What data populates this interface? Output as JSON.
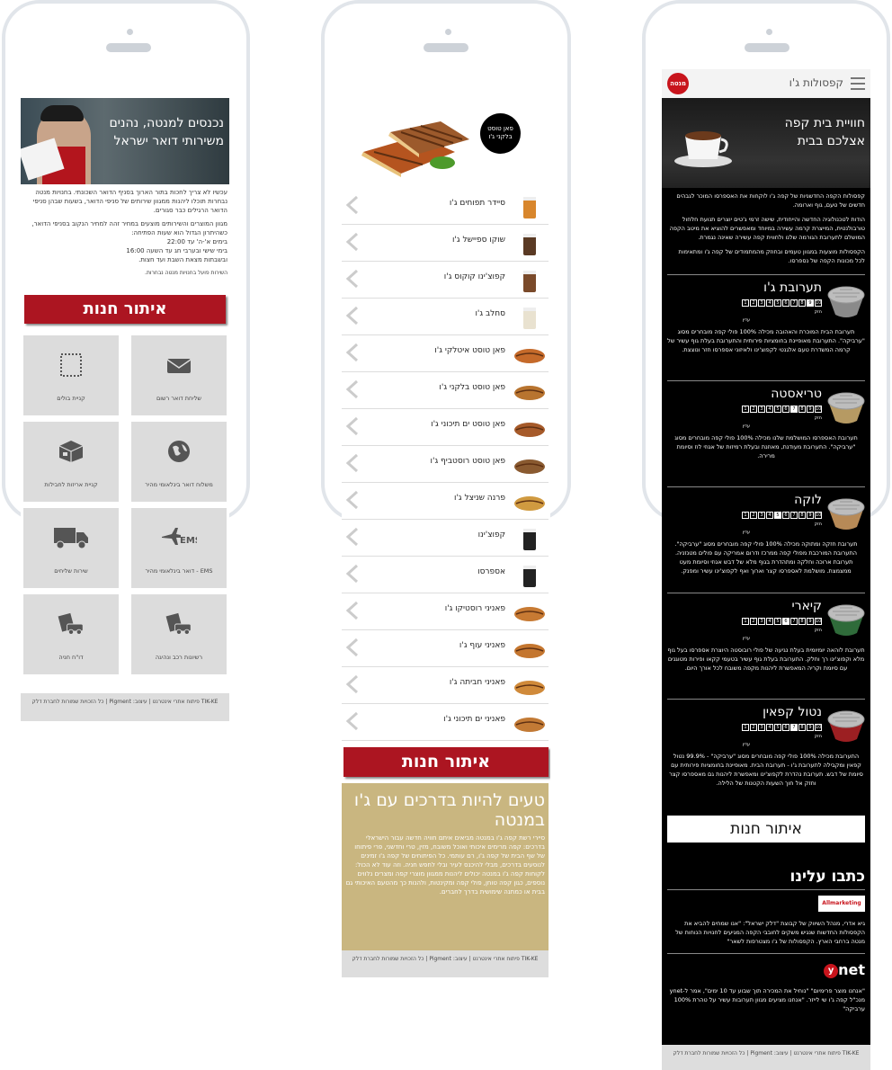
{
  "phone1": {
    "hero_title": "נכנסים למנטה, נהנים משירותי דואר ישראל",
    "paragraphs": [
      "עכשיו לא צריך לחכות בתור הארוך בסניף הדואר השכונתי. בחנויות מנטה נבחרות תוכלו ליהנות ממגוון שירותים של סניפי הדואר, בשעות שבהן סניפי הדואר הרגילים כבר סגורים.",
      "מגוון המוצרים והשירותים מוצעים במחיר זהה למחיר הנקוב בסניפי הדואר, כשהיתרון הגדול הוא שעות הפתיחה:",
      "בימים א'-ה' עד 22:00",
      "בימי שישי ובערבי חג עד השעה 16:00",
      "ובשבתות מצאת השבת ועד חצות.",
      "השירות פועל בחנויות מנטה נבחרות."
    ],
    "store_button": "איתור חנות",
    "tiles": [
      {
        "label": "שליחת דואר רשום",
        "icon": "envelope-icon"
      },
      {
        "label": "קניית בולים",
        "icon": "stamp-icon"
      },
      {
        "label": "משלוח דואר בינלאומי מהיר",
        "icon": "globe-icon"
      },
      {
        "label": "קניית אריזות לחבילות",
        "icon": "box-icon"
      },
      {
        "label": "EMS - דואר בינלאומי מהיר",
        "icon": "ems-plane-icon",
        "icon_text": "EMS"
      },
      {
        "label": "שירות שליחים",
        "icon": "truck-icon"
      },
      {
        "label": "רשיונות רכב ונהיגה",
        "icon": "car-document-icon"
      },
      {
        "label": "דו\"ח חניה",
        "icon": "parking-ticket-icon"
      }
    ],
    "footer": "TIK-KE פיתוח אתרי אינטרנט | עיצוב: Pigment | כל הזכויות שמורות לחברת דלק"
  },
  "phone2": {
    "badge": "פאן טוסט בלקני ג'ו",
    "menu_items": [
      "סיידר תפוחים ג'ו",
      "שוקו ספיישל ג'ו",
      "קפוצ'ינו קוקוס ג'ו",
      "סחלב ג'ו",
      "פאן טוסט איטלקי ג'ו",
      "פאן טוסט בלקני ג'ו",
      "פאן טוסט ים תיכוני ג'ו",
      "פאן טוסט רוסטביף ג'ו",
      "פרנה שניצל ג'ו",
      "קפוצ'ינו",
      "אספרסו",
      "פאניני רוסטיקו ג'ו",
      "פאניני עוף ג'ו",
      "פאניני חביתה ג'ו",
      "פאניני ים תיכוני ג'ו"
    ],
    "store_button": "איתור חנות",
    "promo_title": "טעים להיות בדרכים עם ג'ו במנטה",
    "promo_text": "סיירי רשת קפה ג'ו במנטה מביאים איתם חוויה חדשה עבור הישראלי בדרכים: קפה מרימים איכותי ואוכל משובח, מזין, טרי וחדשני, פרי פיתוחו של שף הבית של קפה ג'ו, רם עותמי. כל הפיתוחים של קפה ג'ו זמינים לנוסעים בדרכים, מבלי להיכנס לעיר ובלי לחפש חניה. וזה עוד לא הכול: לקוחות קפה ג'ו במנטה יכולים ליהנות ממגוון מוצרי קפה ומצרים נלווים נוספים, כגון קפה טוחן, פולי קפה ומקינטות, ולהנות כך מהטעם האיכותי גם בבית או כמתנה שימושית בדרך לחברים.",
    "footer": "TIK-KE פיתוח אתרי אינטרנט | עיצוב: Pigment | כל הזכויות שמורות לחברת דלק"
  },
  "phone3": {
    "top_title": "קפסולות ג'ו",
    "logo_text": "מנטה",
    "hero_title": "חוויית בית קפה אצלכם בבית",
    "intro": [
      "קפסולות הקפה החדשניות של קפה ג'ו לוקחות את האספרסו המוכר לגבהים חדשים של טעם, גוף וארומה.",
      "הודות לטכנולוגיה החדשה והייחודית, שישה זרמי ג'טים יוצרים תנועת חלחול טורבולנטית, המייצרת קרמה עשירה במיוחד ומאפשרים להוציא את מיטב הקפה המושלם לתערובת הגורמה שלנו ולחווית קפה עשירה שאינה נגמרת.",
      "הקפסולות מוצעות במגוון טעמים ובחוזק מהמתמודים של קפה ג'ו ומתאימות לכל מכונות הקפה של נספרסו."
    ],
    "strength_strong": "חזק",
    "strength_weak": "עדין",
    "capsules": [
      {
        "name": "תערובת ג'ו",
        "strength": 9,
        "color": "#8a8a8a",
        "desc": "תערובת הבית המוכרת והאהובה מכילה 100% פולי קפה מובחרים מסוג \"ערביקה\". התערובת מאופיינת בחומציות פירותית והתערובת בעלת גוף עשיר של קרמה המשדרת טעם אלגנטי לקפוצ'ינו ולאיזוני אספרסו חזר ונוצצת."
      },
      {
        "name": "טריאסטה",
        "strength": 7,
        "color": "#b69a63",
        "desc": "תערובת האספרסו המושלמת שלנו מכילה 100% פולי קפה מובחרים מסוג \"ערביקה\". התערובת מעודנת, מאוזנת ובעלת רמיזות של אגוזי לוז וסיומת מרירה."
      },
      {
        "name": "לוקה",
        "strength": 5,
        "color": "#b78a57",
        "desc": "תערובת חזקה ומתוקה מכילה 100% פולי קפה מובחרים מסוג \"ערביקה\". התערובת המורכבת מפולי קפה ממרכז ודרום אמריקה עם פולים מטנזניה. תערובת ארוכה וחלקה ומתהדרת בגוף מלא של דבש אגוזי וסיומת מעט ממצמצת. מושלמת לאספרסו קצר וארוך ואף לקפוצ'ינו עשיר ומפנק."
      },
      {
        "name": "קיארי",
        "strength": 6,
        "color": "#2f6b3a",
        "desc": "תערובת לוהאה יומיומית בעלת נגיעה של פולי רובוסטה היוצרת אספרסו בעל גוף מלא וקפוצ'ינו רך וחלק. התערובת בעלת גוף עשיר בטעמי קקאו ופירות מטוגנים עם סיומת וקריה המאפשרת ליהנות מקפה משובח לכל אורך היום."
      },
      {
        "name": "נטול קפאין",
        "strength": 7,
        "color": "#9c1f22",
        "desc": "התערובת מכילה 100% פולי קפה מובחרים מסוג \"ערביקה\" - 99.9% נטול קפאין ומקבילה לתערובת ג'ו - תערובת הבית. מאופיינת בחומציות פירותית עם סיומת של דבש. תערובת נהדרת לקפוצ'ינו ומאפשרת ליהנות גם מאספרסו קצר וחזק אל חוך השעות הקטנות של הלילה."
      }
    ],
    "store_button": "איתור חנות",
    "write_title": "כתבו עלינו",
    "press": [
      {
        "source": "Allmarketing",
        "text": "גיא אדרי, מנהל השיווק של קבוצת \"דלק ישראל\": \"אנו שמחים להביא את הקפסולות החדשות שנגיש משקים לחובבי הקפה המגיעים לחנויות הנוחות של מנטה ברחבי הארץ. הקפסולות של ג'ו מצטרפות לשאר\""
      },
      {
        "source": "ynet",
        "text": "\"אנחנו מוצר פרימיום\" \"נוחיל את המכירה תוך שבוע עד 10 ימים\", אמר ל-ynet מנכ\"ל קפה ג'ו שי לייזר. \"אנחנו מציעים מגוון תערובות עשיר על טהרת 100% ערביקה\""
      }
    ],
    "footer": "TIK-KE פיתוח אתרי אינטרנט | עיצוב: Pigment | כל הזכויות שמורות לחברת דלק"
  }
}
